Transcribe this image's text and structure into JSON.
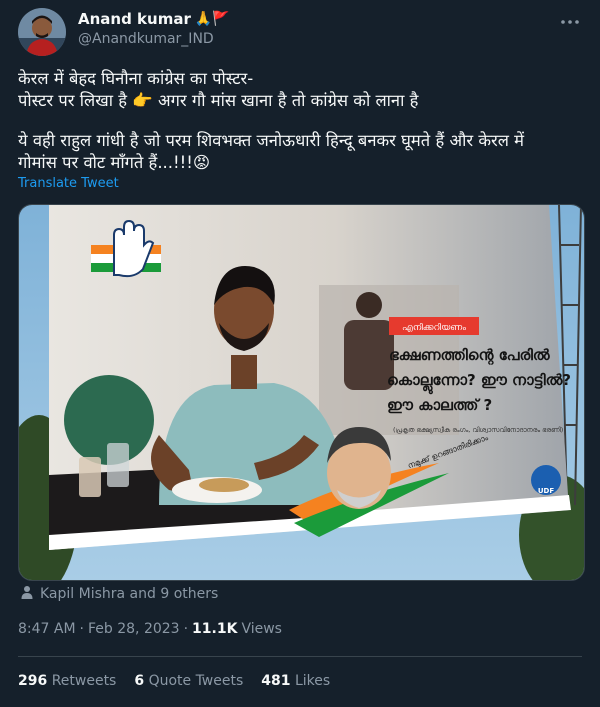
{
  "author": {
    "name": "Anand kumar",
    "badges": "🙏🚩",
    "handle": "@Anandkumar_IND"
  },
  "tweet": {
    "line1": "केरल में बेहद घिनौना कांग्रेस का पोस्टर-",
    "line2": "पोस्टर पर लिखा है 👉 अगर गौ मांस खाना है तो कांग्रेस को लाना है",
    "line3": "ये वही राहुल गांधी है जो परम शिवभक्त जनोऊधारी हिन्दू बनकर घूमते हैं और केरल में",
    "line4": "गोमांस पर वोट माँगते हैं...!!!😡",
    "translate_label": "Translate Tweet"
  },
  "poster": {
    "tag": "എനിക്കറിയണം",
    "headline1": "ഭക്ഷണത്തിന്റെ പേരിൽ",
    "headline2": "കൊല്ലുന്നോ? ഈ നാട്ടിൽ?",
    "headline3": "ഈ കാലത്ത് ?",
    "subline": "(പ്രകൃത ഭക്ഷ്യസ്വീക രംഗം, വിശ്വാസവിനോദാനരം ഭരണി)",
    "slogan": "നമുക്ക് ഉറങ്ങാതിരിക്കാം",
    "party": "UDF"
  },
  "tagged": {
    "label": "Kapil Mishra and 9 others"
  },
  "meta": {
    "time": "8:47 AM",
    "separator1": "·",
    "date": "Feb 28, 2023",
    "separator2": "·",
    "views_count": "11.1K",
    "views_label": "Views"
  },
  "stats": {
    "retweets_count": "296",
    "retweets_label": "Retweets",
    "quotes_count": "6",
    "quotes_label": "Quote Tweets",
    "likes_count": "481",
    "likes_label": "Likes"
  },
  "colors": {
    "background": "#15202b",
    "link": "#1d9bf0",
    "muted": "#8b98a5",
    "border": "#38444d"
  }
}
